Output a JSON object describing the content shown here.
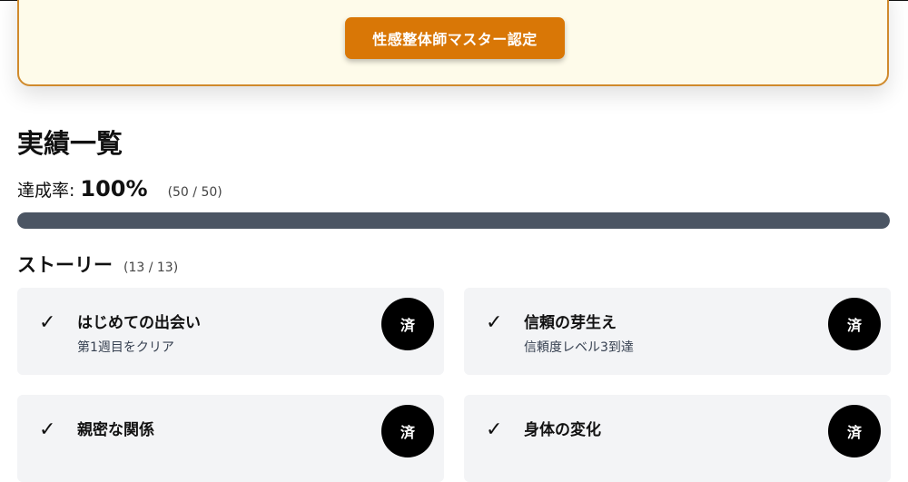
{
  "certification": {
    "button_label": "性感整体師マスター認定"
  },
  "achievements": {
    "title": "実績一覧",
    "rate_label": "達成率:",
    "rate_value": "100%",
    "rate_count": "(50 / 50)",
    "progress": 1.0
  },
  "story": {
    "title": "ストーリー",
    "count": "(13 / 13)",
    "items": [
      {
        "check": "✓",
        "title": "はじめての出会い",
        "desc": "第1週目をクリア",
        "badge": "済"
      },
      {
        "check": "✓",
        "title": "信頼の芽生え",
        "desc": "信頼度レベル3到達",
        "badge": "済"
      },
      {
        "check": "✓",
        "title": "親密な関係",
        "desc": "",
        "badge": "済"
      },
      {
        "check": "✓",
        "title": "身体の変化",
        "desc": "",
        "badge": "済"
      }
    ]
  },
  "colors": {
    "accent": "#d97706",
    "card_bg": "#f3f4f6",
    "progress_fill": "#4b5563",
    "banner_bg": "#fefbea",
    "banner_border": "#d08a2c"
  }
}
